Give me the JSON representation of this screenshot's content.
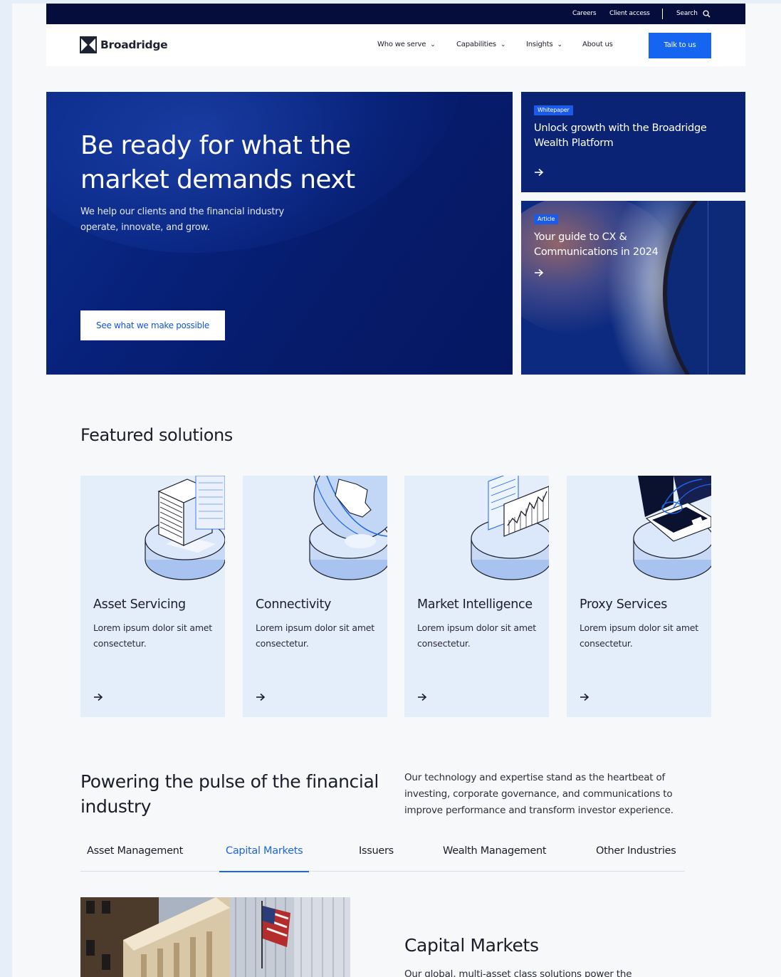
{
  "utility": {
    "careers": "Careers",
    "client_access": "Client access",
    "search": "Search"
  },
  "header": {
    "logo_text": "Broadridge",
    "nav": [
      "Who we serve",
      "Capabilities",
      "Insights",
      "About us"
    ],
    "cta": "Talk to us"
  },
  "hero": {
    "title": "Be ready for what the market demands next",
    "subtitle": "We help our clients and the financial industry operate, innovate, and grow.",
    "button": "See what we make possible"
  },
  "side_cards": [
    {
      "badge": "Whitepaper",
      "title": "Unlock growth with the Broadridge Wealth Platform"
    },
    {
      "badge": "Article",
      "title": "Your guide to CX & Communications in 2024"
    }
  ],
  "featured": {
    "heading": "Featured solutions",
    "items": [
      {
        "title": "Asset Servicing",
        "desc": "Lorem ipsum dolor sit amet consectetur."
      },
      {
        "title": "Connectivity",
        "desc": "Lorem ipsum dolor sit amet consectetur."
      },
      {
        "title": "Market Intelligence",
        "desc": "Lorem ipsum dolor sit amet consectetur."
      },
      {
        "title": "Proxy Services",
        "desc": "Lorem ipsum dolor sit amet consectetur."
      }
    ]
  },
  "pulse": {
    "heading": "Powering the pulse of the financial industry",
    "text": "Our technology and expertise stand as the heartbeat of investing, corporate governance, and communications to improve performance and transform investor experience.",
    "tabs": [
      "Asset Management",
      "Capital Markets",
      "Issuers",
      "Wealth Management",
      "Other Industries"
    ],
    "active_tab": "Capital Markets"
  },
  "capital_markets": {
    "title": "Capital Markets",
    "text": "Our global, multi-asset class solutions power the"
  },
  "icons": {
    "search": "search-icon",
    "chevron": "chevron-down-icon",
    "arrow": "arrow-right-icon",
    "logo": "broadridge-logo-icon"
  },
  "colors": {
    "navy": "#050d3d",
    "hero_blue": "#07217a",
    "accent": "#1565f0",
    "card_bg": "#e4edfa"
  }
}
